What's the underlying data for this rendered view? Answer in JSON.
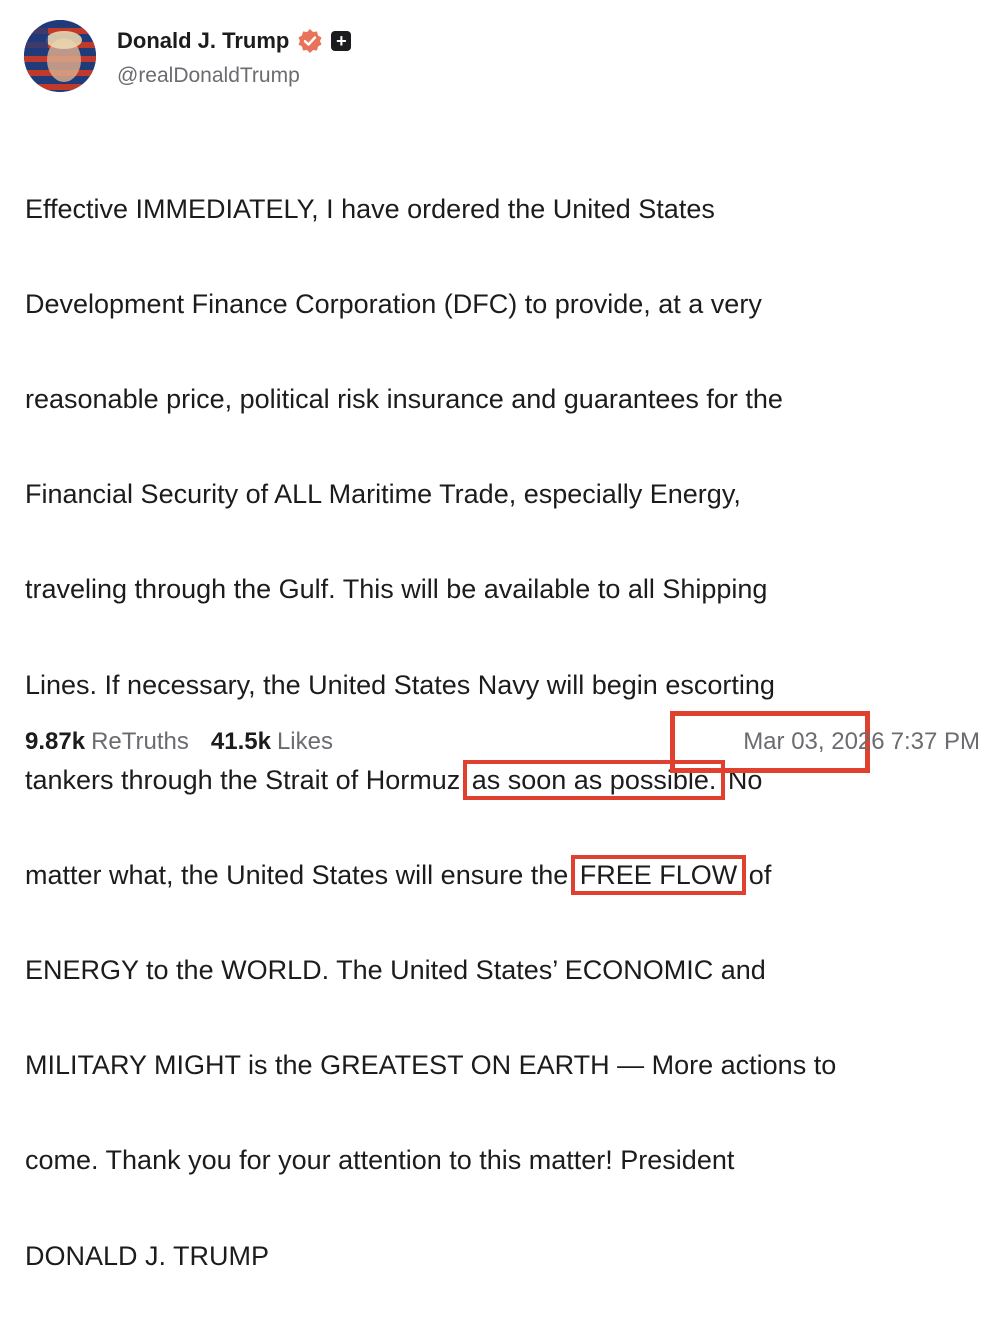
{
  "author": {
    "display_name": "Donald J. Trump",
    "handle": "@realDonaldTrump",
    "avatar_icon": "flag-portrait-avatar",
    "verified_icon": "verified-badge-icon",
    "plus_icon": "plus-badge-icon"
  },
  "post": {
    "lines": [
      "Effective IMMEDIATELY, I have ordered the United States",
      "Development Finance Corporation (DFC) to provide, at a very",
      "reasonable price, political risk insurance and guarantees for the",
      "Financial Security of ALL Maritime Trade, especially Energy,",
      "traveling through the Gulf. This will be available to all Shipping",
      "Lines. If necessary, the United States Navy will begin escorting"
    ],
    "line7_pre": "tankers through the Strait of Hormuz ",
    "line7_highlight": "as soon as possible.",
    "line7_post": " No",
    "line8_pre": "matter what, the United States will ensure the ",
    "line8_highlight": "FREE FLOW",
    "line8_post": " of",
    "lines_after": [
      "ENERGY to the WORLD. The United States’ ECONOMIC and",
      "MILITARY MIGHT is the GREATEST ON EARTH — More actions to",
      "come. Thank you for your attention to this matter! President",
      "DONALD J. TRUMP"
    ]
  },
  "stats": {
    "retruths_count": "9.87k",
    "retruths_label": "ReTruths",
    "likes_count": "41.5k",
    "likes_label": "Likes"
  },
  "timestamp": {
    "date": "Mar 03, 2026",
    "time": "7:37 PM"
  },
  "colors": {
    "highlight_box": "#e0412e",
    "verified_badge": "#e8735a",
    "text": "#1c1c1e",
    "muted": "#6b6b70"
  }
}
